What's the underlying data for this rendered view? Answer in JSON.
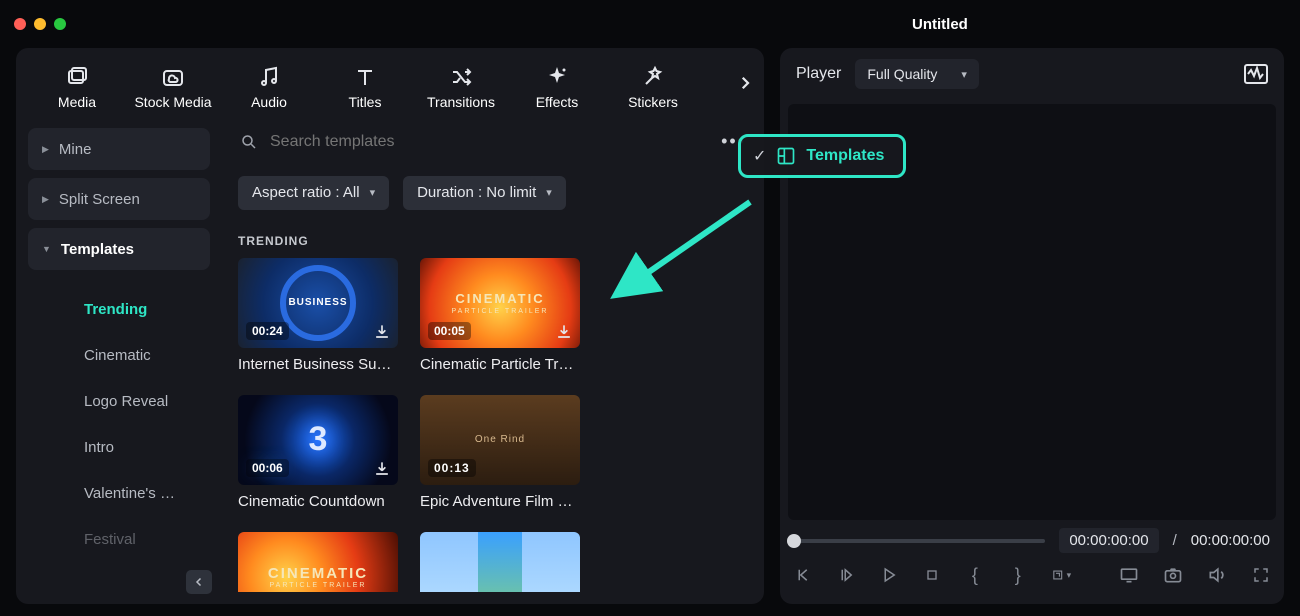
{
  "window": {
    "title": "Untitled"
  },
  "topTabs": [
    {
      "label": "Media",
      "icon": "image-icon"
    },
    {
      "label": "Stock Media",
      "icon": "cloud-image-icon"
    },
    {
      "label": "Audio",
      "icon": "music-note-icon"
    },
    {
      "label": "Titles",
      "icon": "text-t-icon"
    },
    {
      "label": "Transitions",
      "icon": "shuffle-icon"
    },
    {
      "label": "Effects",
      "icon": "sparkle-icon"
    },
    {
      "label": "Stickers",
      "icon": "star-wand-icon"
    }
  ],
  "sidebar": {
    "items": [
      {
        "label": "Mine",
        "expanded": false
      },
      {
        "label": "Split Screen",
        "expanded": false
      },
      {
        "label": "Templates",
        "expanded": true,
        "active": true
      }
    ],
    "templatesSub": [
      {
        "label": "Trending",
        "active": true
      },
      {
        "label": "Cinematic"
      },
      {
        "label": "Logo Reveal"
      },
      {
        "label": "Intro"
      },
      {
        "label": "Valentine's …"
      },
      {
        "label": "Festival"
      }
    ]
  },
  "search": {
    "placeholder": "Search templates"
  },
  "filters": {
    "aspect": "Aspect ratio : All",
    "duration": "Duration : No limit"
  },
  "sectionLabel": "TRENDING",
  "templates": [
    {
      "name": "Internet Business Su…",
      "duration": "00:24",
      "art": "business",
      "dl": true
    },
    {
      "name": "Cinematic Particle Tr…",
      "duration": "00:05",
      "art": "fire",
      "dl": true
    },
    {
      "name": "Cinematic Countdown",
      "duration": "00:06",
      "art": "count",
      "dl": true
    },
    {
      "name": "Epic Adventure Film …",
      "duration": "00:13",
      "art": "epic",
      "dl": false
    },
    {
      "name": "",
      "duration": "",
      "art": "fire2",
      "dl": false
    },
    {
      "name": "",
      "duration": "",
      "art": "sky",
      "dl": false
    }
  ],
  "callout": {
    "label": "Templates"
  },
  "player": {
    "label": "Player",
    "quality": "Full Quality",
    "tc1": "00:00:00:00",
    "sep": "/",
    "tc2": "00:00:00:00"
  }
}
